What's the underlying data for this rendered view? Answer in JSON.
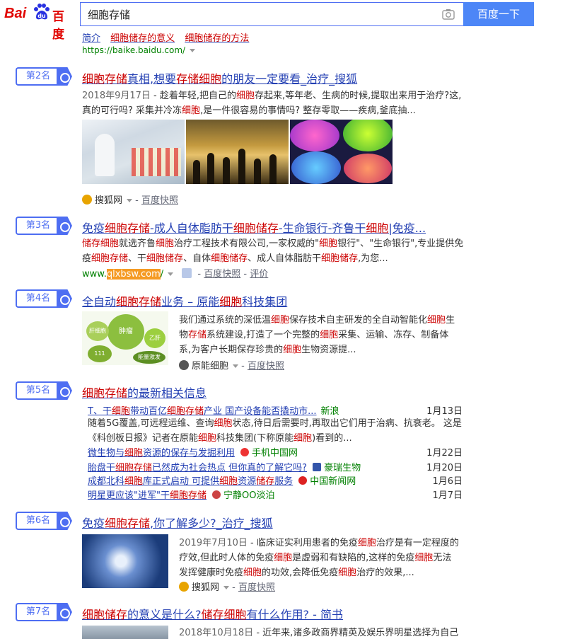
{
  "header": {
    "logo_bai": "Bai",
    "logo_cn": "百度",
    "search_value": "细胞存储",
    "search_button": "百度一下"
  },
  "top": {
    "cut_links": [
      "简介",
      "细胞储存的意义",
      "细胞储存的方法"
    ],
    "url": "https://baike.baidu.com/"
  },
  "results": [
    {
      "rank": "第2名",
      "title": "细胞存储真相,想要存储细胞的朋友一定要看_治疗_搜狐",
      "date": "2018年9月17日",
      "snippet_l1": "- 趁着年轻,把自己的细胞存起来,等年老、生病的时候,提取出来用于治疗?这,",
      "snippet_l2": "真的可行吗? 采集并冷冻细胞,是一件很容易的事情吗? 整存零取——疾病,釜底抽...",
      "source": "搜狐网",
      "kuaizhao": "百度快照"
    },
    {
      "rank": "第3名",
      "title": "免疫细胞存储-成人自体脂肪干细胞储存-生命银行-齐鲁干细胞|免疫...",
      "snippet_l1": "储存细胞就选齐鲁细胞治疗工程技术有限公司,一家权威的\"细胞银行\"、\"生命银行\",专业提供免",
      "snippet_l2": "疫细胞存储、干细胞储存、自体细胞储存、成人自体脂肪干细胞储存,为您...",
      "url_prefix": "www.",
      "url_highlight": "qlxbsw.com",
      "url_suffix": "/",
      "kuaizhao": "百度快照",
      "rating": "评价"
    },
    {
      "rank": "第4名",
      "title": "全自动细胞存储业务 – 原能细胞科技集团",
      "snippet_l1": "我们通过系统的深低温细胞保存技术自主研发的全自动智能化细胞生",
      "snippet_l2": "物存储系统建设,打造了一个完整的细胞采集、运输、冻存、制备体",
      "snippet_l3": "系,为客户长期保存珍贵的细胞生物资源提...",
      "source": "原能细胞",
      "kuaizhao": "百度快照",
      "thumb_labels": [
        "肿瘤",
        "肝细胞",
        "乙肝",
        "111",
        "能量激发"
      ]
    },
    {
      "rank": "第5名",
      "title": "细胞存储的最新相关信息",
      "news": [
        {
          "title": "T、干细胞带动百亿细胞存储产业 国产设备能否撬动市...",
          "source": "新浪",
          "date": "1月13日"
        },
        {
          "title": "微生物与细胞资源的保存与发掘利用",
          "source": "手机中国网",
          "date": "1月22日"
        },
        {
          "title": "胎盘干细胞存储已然成为社会热点 但你真的了解它吗?",
          "source": "豪瑞生物",
          "date": "1月20日"
        },
        {
          "title": "成都北科细胞库正式启动 可提供细胞资源储存服务",
          "source": "中国新闻网",
          "date": "1月6日"
        },
        {
          "title": "明星更应该\"进军\"干细胞存储",
          "source": "宁静OO淡泊",
          "date": "1月7日"
        }
      ],
      "news_desc_l1": "随着5G覆盖,可远程运维、查询细胞状态,待日后需要时,再取出它们用于治病、抗衰老。 这是",
      "news_desc_l2": "《科创板日报》记者在原能细胞科技集团(下称原能细胞)看到的..."
    },
    {
      "rank": "第6名",
      "title": "免疫细胞存储,你了解多少?_治疗_搜狐",
      "date": "2019年7月10日",
      "snippet_l1": "- 临床证实利用患者的免疫细胞治疗是有一定程度的",
      "snippet_l2": "疗效,但此时人体的免疫细胞是虚弱和有缺陷的,这样的免疫细胞无法",
      "snippet_l3": "发挥健康时免疫细胞的功效,会降低免疫细胞治疗的效果,...",
      "source": "搜狐网",
      "kuaizhao": "百度快照"
    },
    {
      "rank": "第7名",
      "title": "细胞储存的意义是什么?储存细胞有什么作用? - 简书",
      "date": "2018年10月18日",
      "snippet_l1": "- 近年来,诸多政商界精英及娱乐界明星选择为自己或"
    }
  ]
}
